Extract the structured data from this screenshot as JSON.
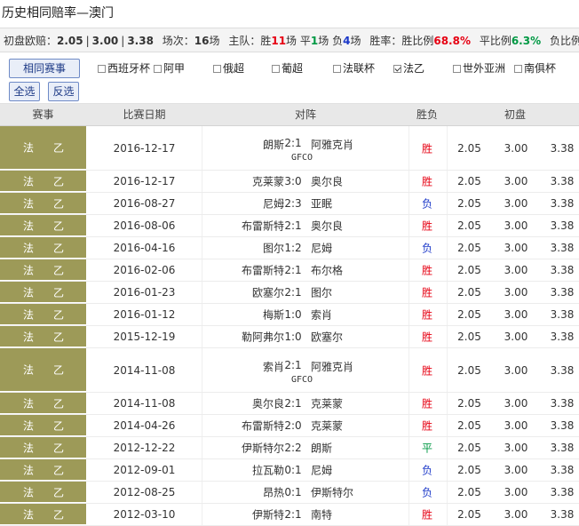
{
  "title": "历史相同赔率—澳门",
  "summary": {
    "odds_label": "初盘欧赔：",
    "odd1": "2.05",
    "odd2": "3.00",
    "odd3": "3.38",
    "count_label": "场次：",
    "count": "16",
    "count_unit": "场",
    "home_label": "主队：胜",
    "win": "11",
    "win_unit": "场",
    "draw_label": "平",
    "draw": "1",
    "draw_unit": "场",
    "lose_label": "负",
    "lose": "4",
    "lose_unit": "场",
    "rate_label": "胜率：胜比例",
    "win_pct": "68.8%",
    "draw_pct_label": "平比例",
    "draw_pct": "6.3%",
    "lose_pct_label": "负比例"
  },
  "filter": {
    "same_btn": "相同赛事",
    "all_btn": "全选",
    "invert_btn": "反选",
    "options": [
      {
        "label": "西班牙杯",
        "checked": false
      },
      {
        "label": "阿甲",
        "checked": false
      },
      {
        "label": "俄超",
        "checked": false
      },
      {
        "label": "葡超",
        "checked": false
      },
      {
        "label": "法联杯",
        "checked": false
      },
      {
        "label": "法乙",
        "checked": true
      },
      {
        "label": "世外亚洲",
        "checked": false
      },
      {
        "label": "南俱杯",
        "checked": false
      }
    ]
  },
  "headers": {
    "comp": "赛事",
    "date": "比赛日期",
    "match": "对阵",
    "result": "胜负",
    "odds": "初盘"
  },
  "colors": {
    "win": "#e60012",
    "draw": "#009944",
    "lose": "#1a37c8",
    "comp_bg": "#9d9a58"
  },
  "rows": [
    {
      "comp1": "法",
      "comp2": "乙",
      "date": "2016-12-17",
      "home": "朗斯",
      "score": "2:1",
      "away": "阿雅克肖",
      "line2": "GFCO",
      "result": "胜",
      "o1": "2.05",
      "o2": "3.00",
      "o3": "3.38"
    },
    {
      "comp1": "法",
      "comp2": "乙",
      "date": "2016-12-17",
      "home": "克莱蒙",
      "score": "3:0",
      "away": "奥尔良",
      "line2": "",
      "result": "胜",
      "o1": "2.05",
      "o2": "3.00",
      "o3": "3.38"
    },
    {
      "comp1": "法",
      "comp2": "乙",
      "date": "2016-08-27",
      "home": "尼姆",
      "score": "2:3",
      "away": "亚眠",
      "line2": "",
      "result": "负",
      "o1": "2.05",
      "o2": "3.00",
      "o3": "3.38"
    },
    {
      "comp1": "法",
      "comp2": "乙",
      "date": "2016-08-06",
      "home": "布雷斯特",
      "score": "2:1",
      "away": "奥尔良",
      "line2": "",
      "result": "胜",
      "o1": "2.05",
      "o2": "3.00",
      "o3": "3.38"
    },
    {
      "comp1": "法",
      "comp2": "乙",
      "date": "2016-04-16",
      "home": "图尔",
      "score": "1:2",
      "away": "尼姆",
      "line2": "",
      "result": "负",
      "o1": "2.05",
      "o2": "3.00",
      "o3": "3.38"
    },
    {
      "comp1": "法",
      "comp2": "乙",
      "date": "2016-02-06",
      "home": "布雷斯特",
      "score": "2:1",
      "away": "布尔格",
      "line2": "",
      "result": "胜",
      "o1": "2.05",
      "o2": "3.00",
      "o3": "3.38"
    },
    {
      "comp1": "法",
      "comp2": "乙",
      "date": "2016-01-23",
      "home": "欧塞尔",
      "score": "2:1",
      "away": "图尔",
      "line2": "",
      "result": "胜",
      "o1": "2.05",
      "o2": "3.00",
      "o3": "3.38"
    },
    {
      "comp1": "法",
      "comp2": "乙",
      "date": "2016-01-12",
      "home": "梅斯",
      "score": "1:0",
      "away": "索肖",
      "line2": "",
      "result": "胜",
      "o1": "2.05",
      "o2": "3.00",
      "o3": "3.38"
    },
    {
      "comp1": "法",
      "comp2": "乙",
      "date": "2015-12-19",
      "home": "勒阿弗尔",
      "score": "1:0",
      "away": "欧塞尔",
      "line2": "",
      "result": "胜",
      "o1": "2.05",
      "o2": "3.00",
      "o3": "3.38"
    },
    {
      "comp1": "法",
      "comp2": "乙",
      "date": "2014-11-08",
      "home": "索肖",
      "score": "2:1",
      "away": "阿雅克肖",
      "line2": "GFCO",
      "result": "胜",
      "o1": "2.05",
      "o2": "3.00",
      "o3": "3.38"
    },
    {
      "comp1": "法",
      "comp2": "乙",
      "date": "2014-11-08",
      "home": "奥尔良",
      "score": "2:1",
      "away": "克莱蒙",
      "line2": "",
      "result": "胜",
      "o1": "2.05",
      "o2": "3.00",
      "o3": "3.38"
    },
    {
      "comp1": "法",
      "comp2": "乙",
      "date": "2014-04-26",
      "home": "布雷斯特",
      "score": "2:0",
      "away": "克莱蒙",
      "line2": "",
      "result": "胜",
      "o1": "2.05",
      "o2": "3.00",
      "o3": "3.38"
    },
    {
      "comp1": "法",
      "comp2": "乙",
      "date": "2012-12-22",
      "home": "伊斯特尔",
      "score": "2:2",
      "away": "朗斯",
      "line2": "",
      "result": "平",
      "o1": "2.05",
      "o2": "3.00",
      "o3": "3.38"
    },
    {
      "comp1": "法",
      "comp2": "乙",
      "date": "2012-09-01",
      "home": "拉瓦勒",
      "score": "0:1",
      "away": "尼姆",
      "line2": "",
      "result": "负",
      "o1": "2.05",
      "o2": "3.00",
      "o3": "3.38"
    },
    {
      "comp1": "法",
      "comp2": "乙",
      "date": "2012-08-25",
      "home": "昂热",
      "score": "0:1",
      "away": "伊斯特尔",
      "line2": "",
      "result": "负",
      "o1": "2.05",
      "o2": "3.00",
      "o3": "3.38"
    },
    {
      "comp1": "法",
      "comp2": "乙",
      "date": "2012-03-10",
      "home": "伊斯特",
      "score": "2:1",
      "away": "南特",
      "line2": "",
      "result": "胜",
      "o1": "2.05",
      "o2": "3.00",
      "o3": "3.38"
    }
  ]
}
